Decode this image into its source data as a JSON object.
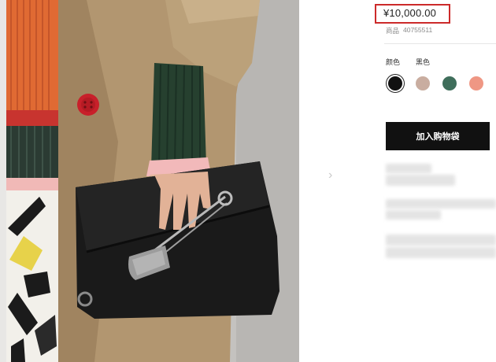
{
  "product": {
    "price": "¥10,000.00",
    "sku_label": "商品",
    "sku_number": "40755511"
  },
  "colors": {
    "label": "颜色",
    "selected_name": "黑色",
    "swatches": [
      {
        "name": "black",
        "hex": "#111111"
      },
      {
        "name": "taupe",
        "hex": "#c9ada0"
      },
      {
        "name": "green",
        "hex": "#3f6e5b"
      },
      {
        "name": "coral",
        "hex": "#ef9784"
      }
    ]
  },
  "actions": {
    "add_to_bag_label": "加入购物袋"
  },
  "page": {
    "next_arrow": "›"
  },
  "theme": {
    "accent_red": "#cc2a2a",
    "button_bg": "#111111"
  }
}
